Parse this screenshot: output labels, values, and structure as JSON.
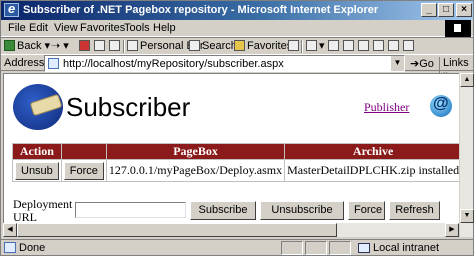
{
  "window": {
    "title": "Subscriber of .NET Pagebox repository - Microsoft Internet Explorer"
  },
  "menu": [
    "File",
    "Edit",
    "View",
    "Favorites",
    "Tools",
    "Help"
  ],
  "toolbar": {
    "back": "Back",
    "personal_bar": "Personal Bar",
    "search": "Search",
    "favorites": "Favorites"
  },
  "address": {
    "label": "Address",
    "url": "http://localhost/myRepository/subscriber.aspx",
    "go": "Go",
    "links": "Links"
  },
  "page": {
    "title": "Subscriber",
    "publisher_link": "Publisher"
  },
  "table": {
    "headers": [
      "Action",
      "",
      "PageBox",
      "Archive"
    ],
    "rows": [
      {
        "unsub": "Unsub",
        "force": "Force",
        "pagebox": "127.0.0.1/myPageBox/Deploy.asmx",
        "archive": "MasterDetailDPLCHK.zip installed"
      }
    ]
  },
  "deployment": {
    "label_line1": "Deployment",
    "label_line2": "URL",
    "input_value": "",
    "subscribe": "Subscribe",
    "unsubscribe": "Unsubscribe",
    "force": "Force",
    "refresh": "Refresh"
  },
  "status": {
    "text": "Done",
    "zone": "Local intranet"
  },
  "colors": {
    "header_bg": "#8b1a1a",
    "titlebar": "#0a246a",
    "link": "#800080"
  }
}
